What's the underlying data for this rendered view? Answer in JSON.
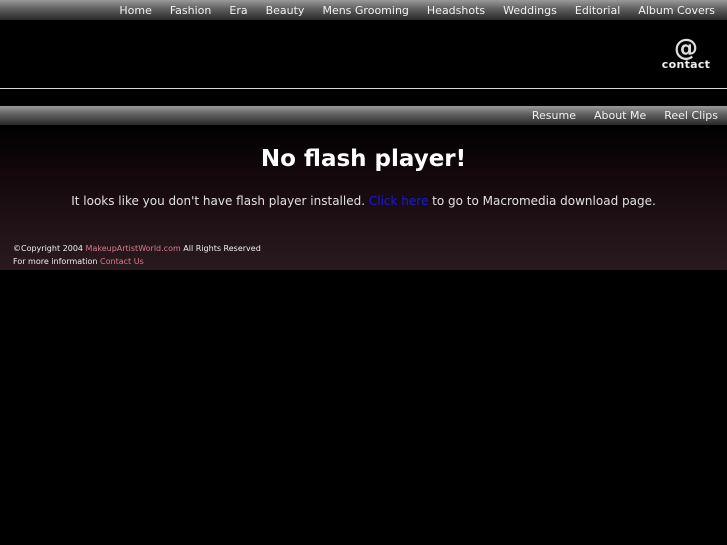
{
  "top_nav": {
    "items": [
      "Home",
      "Fashion",
      "Era",
      "Beauty",
      "Mens Grooming",
      "Headshots",
      "Weddings",
      "Editorial",
      "Album Covers"
    ]
  },
  "contact_logo": {
    "symbol": "@",
    "label": "contact"
  },
  "sub_nav": {
    "items": [
      "Resume",
      "About Me",
      "Reel Clips"
    ]
  },
  "main": {
    "headline": "No flash player!",
    "message_prefix": "It looks like you don't have flash player installed.",
    "link_text": "Click here",
    "message_suffix": "to go to Macromedia download page."
  },
  "footer": {
    "copyright_prefix": "©Copyright 2004",
    "site_link": "MakeupArtistWorld.com",
    "copyright_suffix": "All Rights Reserved",
    "info_prefix": "For more information",
    "contact_link": "Contact Us"
  },
  "colors": {
    "background": "#000000",
    "link_blue": "#1a1adb",
    "link_pink": "#d97a8e"
  }
}
